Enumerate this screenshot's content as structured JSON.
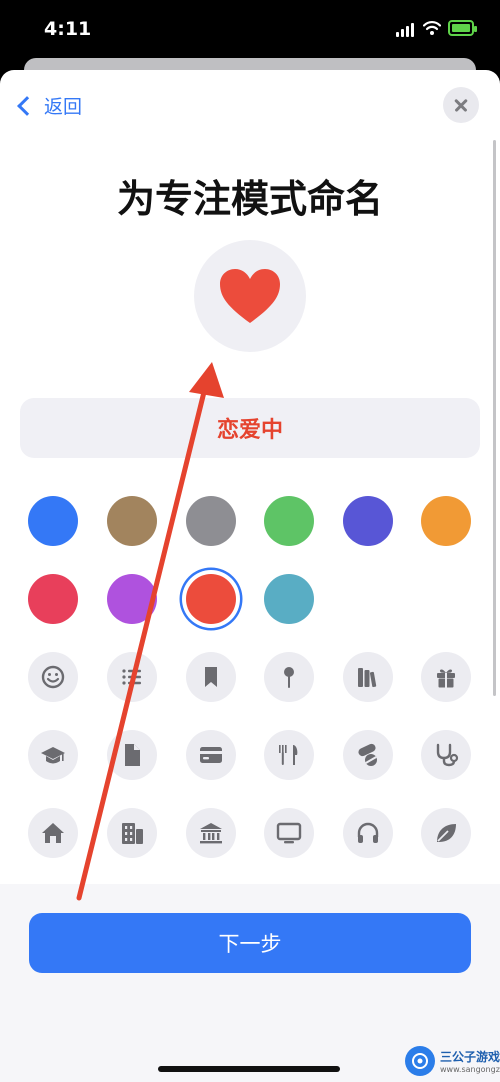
{
  "status_bar": {
    "time": "4:11"
  },
  "header": {
    "back_label": "返回"
  },
  "title": "为专注模式命名",
  "name_field": {
    "value": "恋爱中"
  },
  "colors": [
    {
      "name": "blue",
      "hex": "#3478f6"
    },
    {
      "name": "brown",
      "hex": "#a2845e"
    },
    {
      "name": "gray",
      "hex": "#8e8e93"
    },
    {
      "name": "green",
      "hex": "#5ec466"
    },
    {
      "name": "indigo",
      "hex": "#5856d6"
    },
    {
      "name": "orange",
      "hex": "#f19a35"
    },
    {
      "name": "pink",
      "hex": "#e83f5b"
    },
    {
      "name": "purple",
      "hex": "#af52de"
    },
    {
      "name": "red",
      "hex": "#ec4c3c",
      "selected": true
    },
    {
      "name": "teal",
      "hex": "#59adc4"
    }
  ],
  "icons": [
    "smiley-icon",
    "list-icon",
    "bookmark-icon",
    "pin-icon",
    "books-icon",
    "gift-icon",
    "graduation-cap-icon",
    "document-icon",
    "credit-card-icon",
    "fork-knife-icon",
    "pills-icon",
    "stethoscope-icon",
    "house-icon",
    "building-icon",
    "bank-icon",
    "tv-icon",
    "headphones-icon",
    "leaf-icon"
  ],
  "next_button": {
    "label": "下一步"
  },
  "watermark": {
    "site_name": "三公子游戏网",
    "url": "www.sangongzi.net"
  },
  "accent_color": "#3478f6",
  "annotation_color": "#e5432e"
}
